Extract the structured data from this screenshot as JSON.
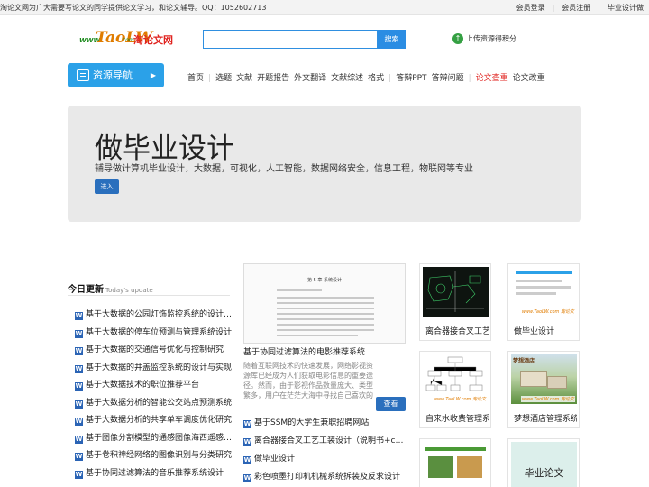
{
  "topbar": {
    "notice": "淘论文网为广大需要写论文的同学提供论文学习，和论文辅导。QQ：1052602713",
    "links": [
      "会员登录",
      "会员注册",
      "毕业设计做"
    ],
    "separator": "|"
  },
  "logo": {
    "www": "WWW.",
    "tao": "TaoLW",
    "com": ".com",
    "cn": "淘论文网"
  },
  "search": {
    "value": "",
    "button": "搜索"
  },
  "upload": {
    "icon": "upload-circle-icon",
    "label": "上传资源得积分"
  },
  "resource_nav": {
    "label": "资源导航",
    "icon": "document-list-icon",
    "arrow": "▶"
  },
  "menu": {
    "items": [
      "首页",
      "选题",
      "文献",
      "开题报告",
      "外文翻译",
      "文献综述",
      "格式",
      "答辩PPT",
      "答辩问题",
      "论文查重",
      "论文改重"
    ],
    "highlight": "论文查重"
  },
  "hero": {
    "title": "做毕业设计",
    "subtitle": "辅导做计算机毕业设计，大数据，可视化，人工智能，数据网络安全，信息工程，物联网等专业",
    "button": "进入"
  },
  "today": {
    "title": "今日更新",
    "title_en": "Today's update",
    "items": [
      "基于大数据的公园灯饰监控系统的设计与实现",
      "基于大数据的停车位预测与管理系统设计",
      "基于大数据的交通信号优化与控制研究",
      "基于大数据的井盖监控系统的设计与实现",
      "基于大数据技术的职位推荐平台",
      "基于大数据分析的智能公交站点预测系统",
      "基于大数据分析的共享单车调度优化研究",
      "基于图像分割模型的通感图像海西遥感分析",
      "基于卷积神经网络的图像识别与分类研究",
      "基于协同过滤算法的音乐推荐系统设计"
    ]
  },
  "featured": {
    "doc_heading": "第 5 章 系统设计",
    "caption": "基于协同过滤算法的电影推荐系统",
    "desc": "随着互联网技术的快速发展，网络影视资源库已经成为人们获取电影信息的重要途径。然而，由于影视作品数量庞大、类型繁多，用户在茫茫大海中寻找自己喜欢的电影往往需要花费…",
    "button": "查看"
  },
  "mid_list": [
    "基于SSM的大学生兼职招聘网站",
    "离合器接合叉工艺工装设计（说明书+cad图纸）",
    "做毕业设计",
    "彩色喷墨打印机机械系统拆装及反求设计"
  ],
  "watermark": "www.TaoLW.com 淘论文",
  "cards": [
    {
      "caption": "离合器接合叉工艺工装设计"
    },
    {
      "caption": "做毕业设计"
    },
    {
      "caption": "自来水收费管理系统"
    },
    {
      "caption": "梦想酒店管理系统",
      "overlay": "梦想酒店"
    },
    {
      "caption": ""
    },
    {
      "caption": ""
    },
    {
      "caption": "",
      "overlay": "毕业论文"
    }
  ],
  "colors": {
    "accent": "#2ba1e8",
    "button": "#2a6fbd",
    "hot": "#e0231f",
    "hero_bg": "#e9e9e9"
  }
}
